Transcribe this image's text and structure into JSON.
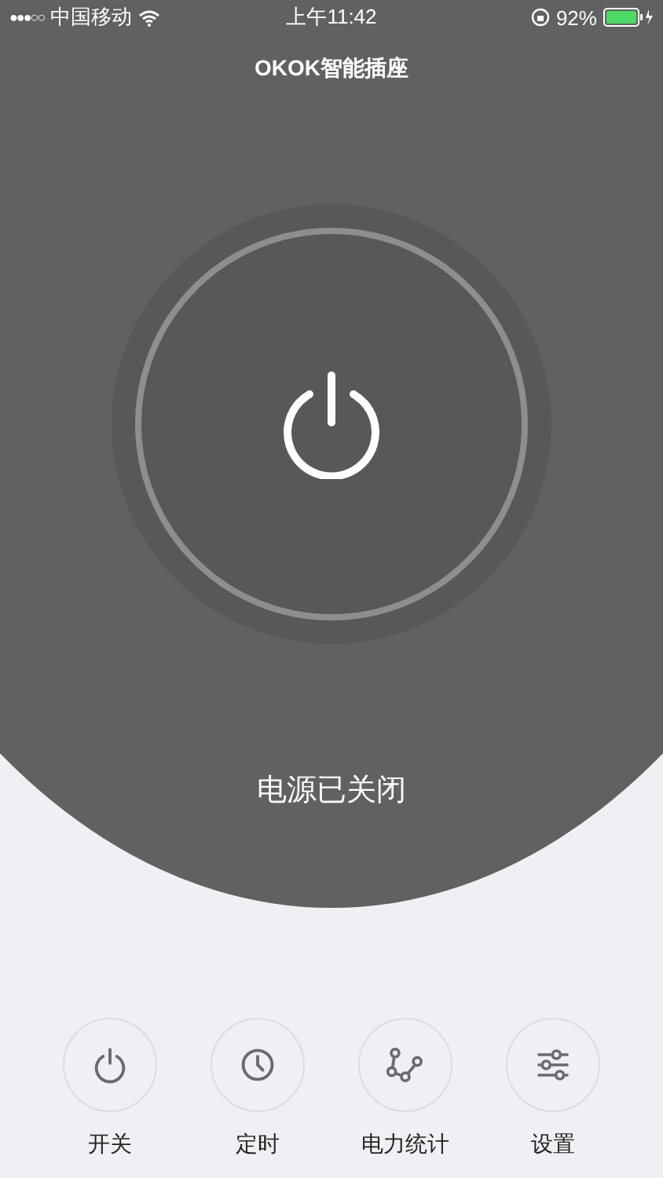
{
  "status_bar": {
    "signal": "●●●○○",
    "carrier": "中国移动",
    "time": "上午11:42",
    "battery": "92%"
  },
  "title": "OKOK智能插座",
  "power": {
    "on": false,
    "status_text": "电源已关闭"
  },
  "actions": [
    {
      "kind": "power",
      "label": "开关"
    },
    {
      "kind": "timer",
      "label": "定时"
    },
    {
      "kind": "stats",
      "label": "电力统计"
    },
    {
      "kind": "settings",
      "label": "设置"
    }
  ]
}
